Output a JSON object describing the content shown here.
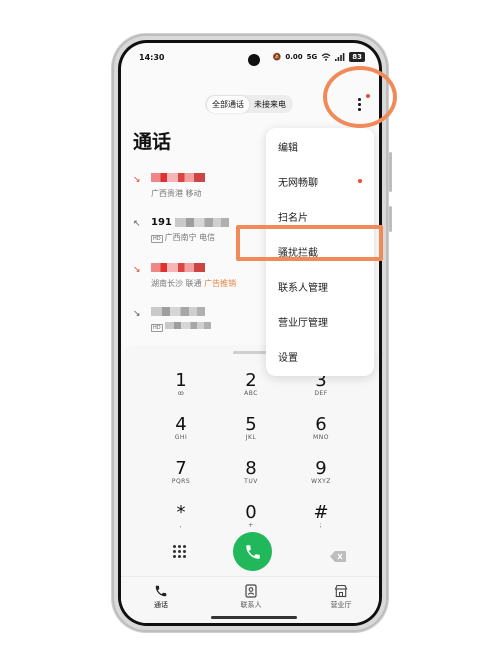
{
  "status_bar": {
    "time": "14:30",
    "network": "5G",
    "wifi_speed": "0.00",
    "battery": "83"
  },
  "filter_tabs": [
    {
      "label": "全部通话",
      "active": true
    },
    {
      "label": "未接来电",
      "active": false
    }
  ],
  "page_title": "通话",
  "calls": [
    {
      "type": "missed",
      "number": "",
      "location": "广西贵港",
      "carrier": "移动",
      "tag": "",
      "number_redacted": true,
      "redaction_color": "red"
    },
    {
      "type": "outgoing",
      "number": "191",
      "location": "广西南宁",
      "carrier": "电信",
      "tag": "",
      "number_redacted": true,
      "redaction_color": "gray",
      "sim_badge": "HD"
    },
    {
      "type": "missed",
      "number": "",
      "location": "湖南长沙",
      "carrier": "联通",
      "tag": "广告推销",
      "number_redacted": true,
      "redaction_color": "red"
    },
    {
      "type": "incoming",
      "number": "",
      "location": "",
      "carrier": "",
      "tag": "",
      "number_redacted": true,
      "redaction_color": "gray",
      "sim_badge": "HD"
    }
  ],
  "menu": {
    "items": [
      {
        "label": "编辑"
      },
      {
        "label": "无网畅聊",
        "badge": true
      },
      {
        "label": "扫名片"
      },
      {
        "label": "骚扰拦截",
        "highlighted": true
      },
      {
        "label": "联系人管理"
      },
      {
        "label": "营业厅管理"
      },
      {
        "label": "设置"
      }
    ]
  },
  "dialpad": [
    {
      "digit": "1",
      "letters": "ꝏ"
    },
    {
      "digit": "2",
      "letters": "ABC"
    },
    {
      "digit": "3",
      "letters": "DEF"
    },
    {
      "digit": "4",
      "letters": "GHI"
    },
    {
      "digit": "5",
      "letters": "JKL"
    },
    {
      "digit": "6",
      "letters": "MNO"
    },
    {
      "digit": "7",
      "letters": "PQRS"
    },
    {
      "digit": "8",
      "letters": "TUV"
    },
    {
      "digit": "9",
      "letters": "WXYZ"
    },
    {
      "digit": "*",
      "letters": ","
    },
    {
      "digit": "0",
      "letters": "+"
    },
    {
      "digit": "#",
      "letters": ";"
    }
  ],
  "bottom_nav": [
    {
      "label": "通话",
      "icon": "phone-icon",
      "active": true
    },
    {
      "label": "联系人",
      "icon": "contact-card-icon",
      "active": false
    },
    {
      "label": "营业厅",
      "icon": "store-icon",
      "active": false
    }
  ],
  "colors": {
    "accent_call": "#20b85a",
    "annotation": "#f08a58",
    "ad_tag": "#e0823c",
    "badge_red": "#e2503c"
  }
}
